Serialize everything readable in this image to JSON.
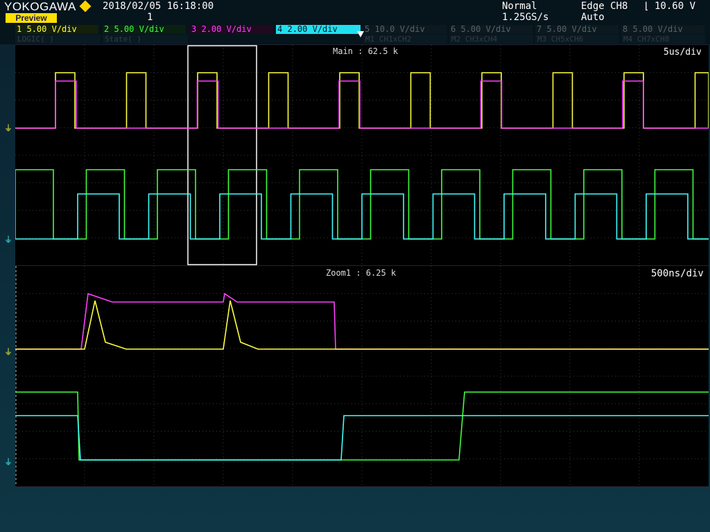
{
  "header": {
    "brand": "YOKOGAWA",
    "preview_label": "Preview",
    "datetime": "2018/02/05 16:18:00",
    "record_number": "1",
    "acq_mode": "Normal",
    "sample_rate": "1.25GS/s",
    "trigger_type": "Edge CH8",
    "trigger_level": "10.60 V",
    "trigger_mode": "Auto"
  },
  "channels": [
    {
      "num": "1",
      "scale": "5.00 V/div",
      "color": "#ffff40"
    },
    {
      "num": "2",
      "scale": "5.00 V/div",
      "color": "#40ff40"
    },
    {
      "num": "3",
      "scale": "2.00 V/div",
      "color": "#ff40ff"
    },
    {
      "num": "4",
      "scale": "2.00 V/div",
      "color": "#40ffff"
    },
    {
      "num": "5",
      "scale": "10.0 V/div",
      "color": "#8a9096"
    },
    {
      "num": "6",
      "scale": "5.00 V/div",
      "color": "#8a9096"
    },
    {
      "num": "7",
      "scale": "5.00 V/div",
      "color": "#8a9096"
    },
    {
      "num": "8",
      "scale": "5.00 V/div",
      "color": "#8a9096"
    }
  ],
  "math_row": {
    "logic": "LOGIC( )",
    "state": "State( )",
    "m1": "M1 CH1xCH2",
    "m2": "M2 CH3xCH4",
    "m3": "M3 CH5xCH6",
    "m4": "M4 CH7xCH8"
  },
  "main_window": {
    "label": "Main : 62.5 k",
    "timebase": "5us/div"
  },
  "zoom_window": {
    "label": "Zoom1 : 6.25 k",
    "timebase": "500ns/div"
  },
  "ground_marker": "⏚"
}
